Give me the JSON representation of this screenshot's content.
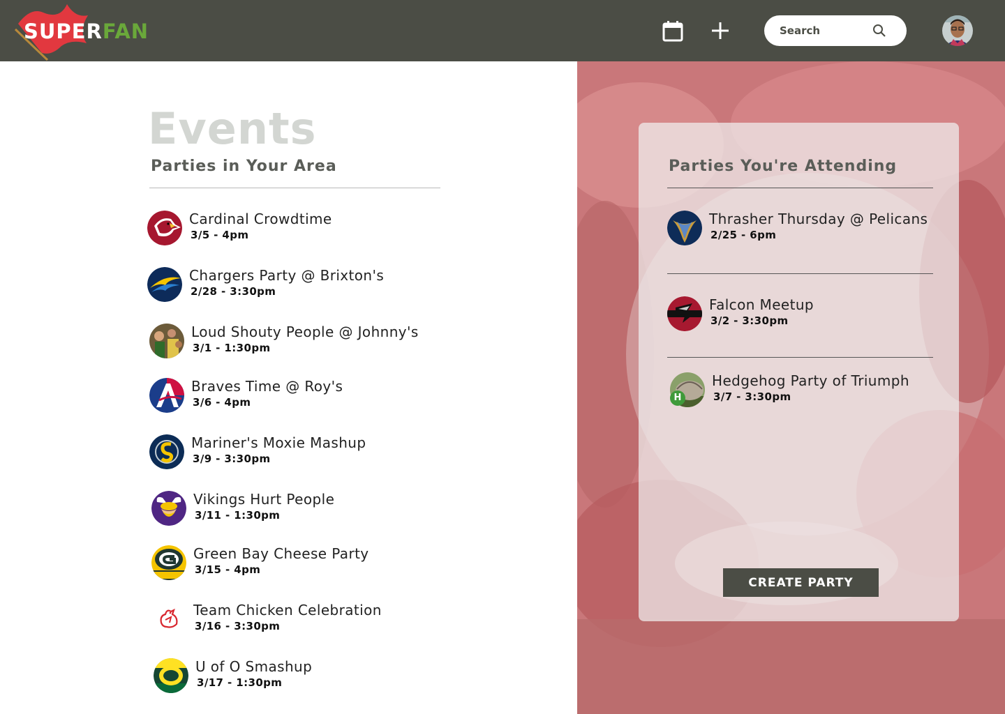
{
  "header": {
    "logo_super": "SUPER",
    "logo_fan": "FAN",
    "search": {
      "placeholder": "Search"
    }
  },
  "page": {
    "title": "Events",
    "nearby_heading": "Parties in Your Area",
    "attending_heading": "Parties You're Attending"
  },
  "nearby": [
    {
      "name": "Cardinal Crowdtime",
      "date": "3/5 - 4pm",
      "icon": "cardinals-logo-icon"
    },
    {
      "name": "Chargers Party @ Brixton's",
      "date": "2/28 - 3:30pm",
      "icon": "chargers-logo-icon"
    },
    {
      "name": "Loud Shouty People @ Johnny's",
      "date": "3/1 - 1:30pm",
      "icon": "crowd-photo-icon"
    },
    {
      "name": "Braves Time @ Roy's",
      "date": "3/6 - 4pm",
      "icon": "braves-logo-icon"
    },
    {
      "name": "Mariner's Moxie Mashup",
      "date": "3/9 - 3:30pm",
      "icon": "mariners-logo-icon"
    },
    {
      "name": "Vikings Hurt People",
      "date": "3/11 - 1:30pm",
      "icon": "vikings-logo-icon"
    },
    {
      "name": "Green Bay Cheese Party",
      "date": "3/15 - 4pm",
      "icon": "packers-logo-icon"
    },
    {
      "name": "Team Chicken Celebration",
      "date": "3/16 - 3:30pm",
      "icon": "chicken-logo-icon"
    },
    {
      "name": "U of O Smashup",
      "date": "3/17 - 1:30pm",
      "icon": "oregon-logo-icon"
    }
  ],
  "attending": [
    {
      "name": "Thrasher Thursday @ Pelicans",
      "date": "2/25 - 6pm",
      "icon": "thrashers-logo-icon"
    },
    {
      "name": "Falcon Meetup",
      "date": "3/2 - 3:30pm",
      "icon": "falcons-logo-icon"
    },
    {
      "name": "Hedgehog Party of Triumph",
      "date": "3/7 - 3:30pm",
      "icon": "hedgehog-photo-icon",
      "badge": "H"
    }
  ],
  "actions": {
    "create_party": "CREATE PARTY"
  },
  "colors": {
    "header_bg": "#4b4d45",
    "brand_red": "#e2383f",
    "brand_green": "#6aa83a",
    "hero_tint": "#c9777a"
  }
}
